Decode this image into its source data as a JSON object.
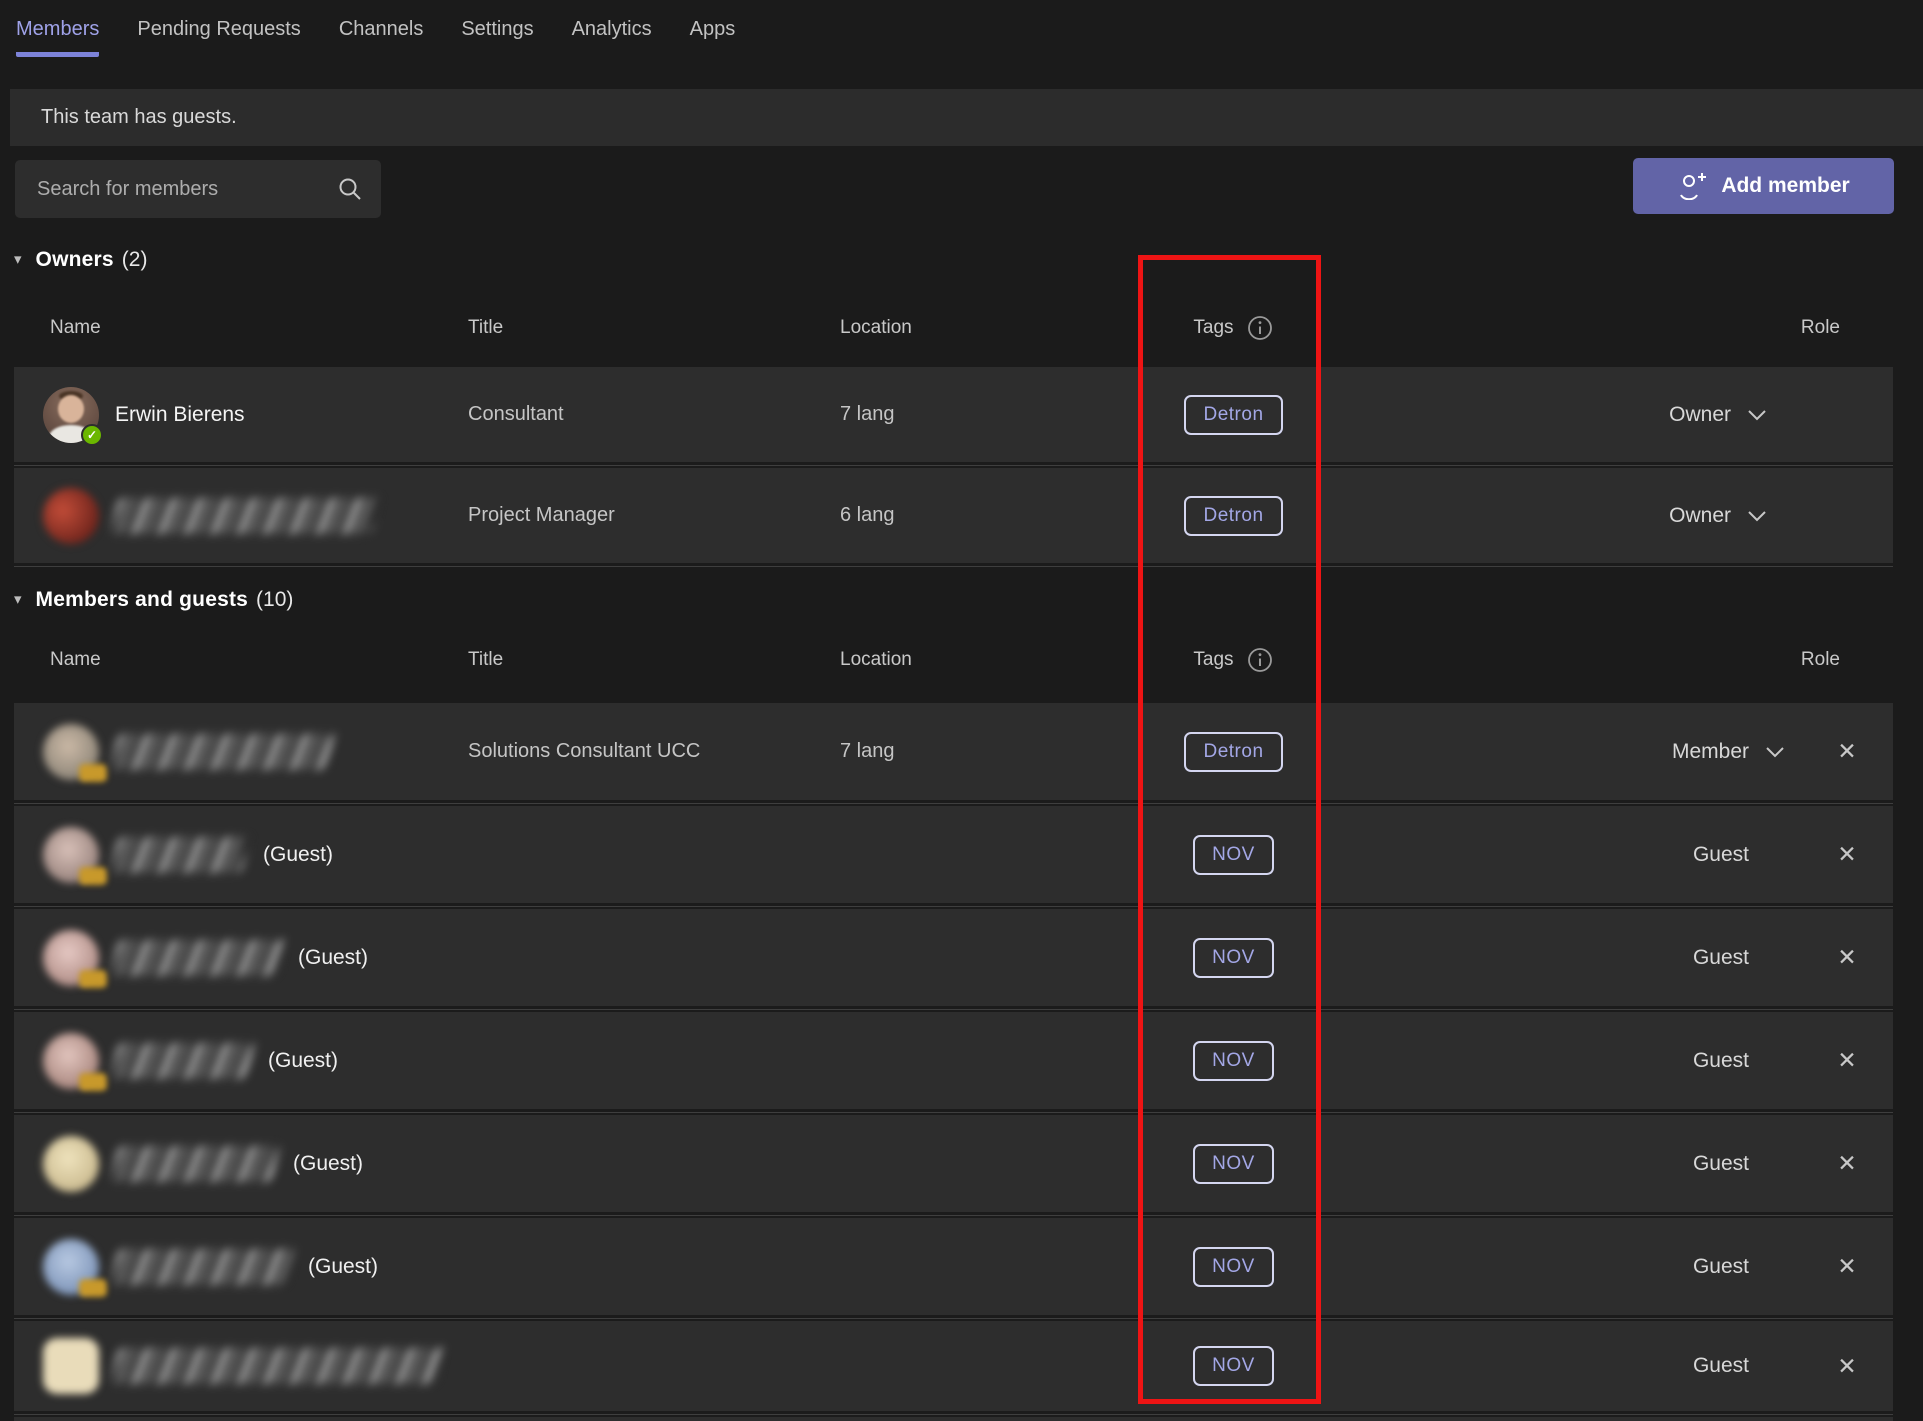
{
  "tabs": {
    "items": [
      {
        "label": "Members",
        "active": true
      },
      {
        "label": "Pending Requests",
        "active": false
      },
      {
        "label": "Channels",
        "active": false
      },
      {
        "label": "Settings",
        "active": false
      },
      {
        "label": "Analytics",
        "active": false
      },
      {
        "label": "Apps",
        "active": false
      }
    ]
  },
  "banner": {
    "message": "This team has guests."
  },
  "toolbar": {
    "search_placeholder": "Search for members",
    "add_member_label": "Add member"
  },
  "columns": {
    "name": "Name",
    "title": "Title",
    "location": "Location",
    "tags": "Tags",
    "role": "Role"
  },
  "labels": {
    "guest_suffix": "(Guest)"
  },
  "sections": [
    {
      "title": "Owners",
      "count": "(2)",
      "rows": [
        {
          "name": "Erwin Bierens",
          "redacted": false,
          "title": "Consultant",
          "location": "7 lang",
          "tag": "Detron",
          "role": "Owner"
        },
        {
          "name": "",
          "redacted": true,
          "title": "Project Manager",
          "location": "6 lang",
          "tag": "Detron",
          "role": "Owner"
        }
      ]
    },
    {
      "title": "Members and guests",
      "count": "(10)",
      "rows": [
        {
          "name": "",
          "redacted": true,
          "title": "Solutions Consultant UCC",
          "location": "7 lang",
          "tag": "Detron",
          "role": "Member"
        },
        {
          "name": "",
          "redacted": true,
          "guest": true,
          "title": "",
          "location": "",
          "tag": "NOV",
          "role": "Guest"
        },
        {
          "name": "",
          "redacted": true,
          "guest": true,
          "title": "",
          "location": "",
          "tag": "NOV",
          "role": "Guest"
        },
        {
          "name": "",
          "redacted": true,
          "guest": true,
          "title": "",
          "location": "",
          "tag": "NOV",
          "role": "Guest"
        },
        {
          "name": "",
          "redacted": true,
          "guest": true,
          "title": "",
          "location": "",
          "tag": "NOV",
          "role": "Guest"
        },
        {
          "name": "",
          "redacted": true,
          "guest": true,
          "title": "",
          "location": "",
          "tag": "NOV",
          "role": "Guest"
        },
        {
          "name": "",
          "redacted": true,
          "guest": false,
          "title": "",
          "location": "",
          "tag": "NOV",
          "role": "Guest"
        }
      ]
    }
  ],
  "colors": {
    "accent_button": "#6264a7",
    "active_tab_text": "#9fa2e8",
    "active_tab_underline": "#7d83d9",
    "tag_text": "#a3a7e6",
    "annotation_rectangle": "#ee1414",
    "presence_available": "#6bb700",
    "guest_badge": "#c8992b"
  }
}
